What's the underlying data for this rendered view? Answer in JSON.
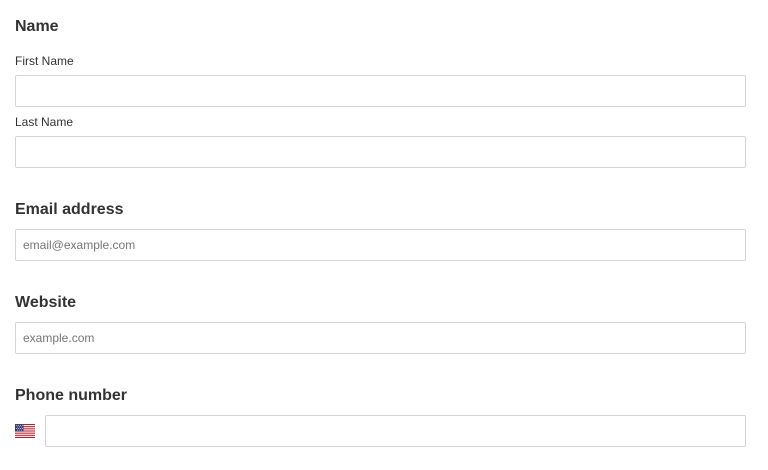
{
  "name_section": {
    "title": "Name",
    "first_name": {
      "label": "First Name",
      "value": "",
      "placeholder": ""
    },
    "last_name": {
      "label": "Last Name",
      "value": "",
      "placeholder": ""
    }
  },
  "email_section": {
    "title": "Email address",
    "value": "",
    "placeholder": "email@example.com"
  },
  "website_section": {
    "title": "Website",
    "value": "",
    "placeholder": "example.com"
  },
  "phone_section": {
    "title": "Phone number",
    "country_flag_icon": "us-flag-icon",
    "value": "",
    "placeholder": ""
  },
  "colors": {
    "input_border": "#d1d5db",
    "text": "#333333",
    "placeholder": "#777777",
    "flag_red": "#b22234",
    "flag_blue": "#3c3b6e"
  }
}
